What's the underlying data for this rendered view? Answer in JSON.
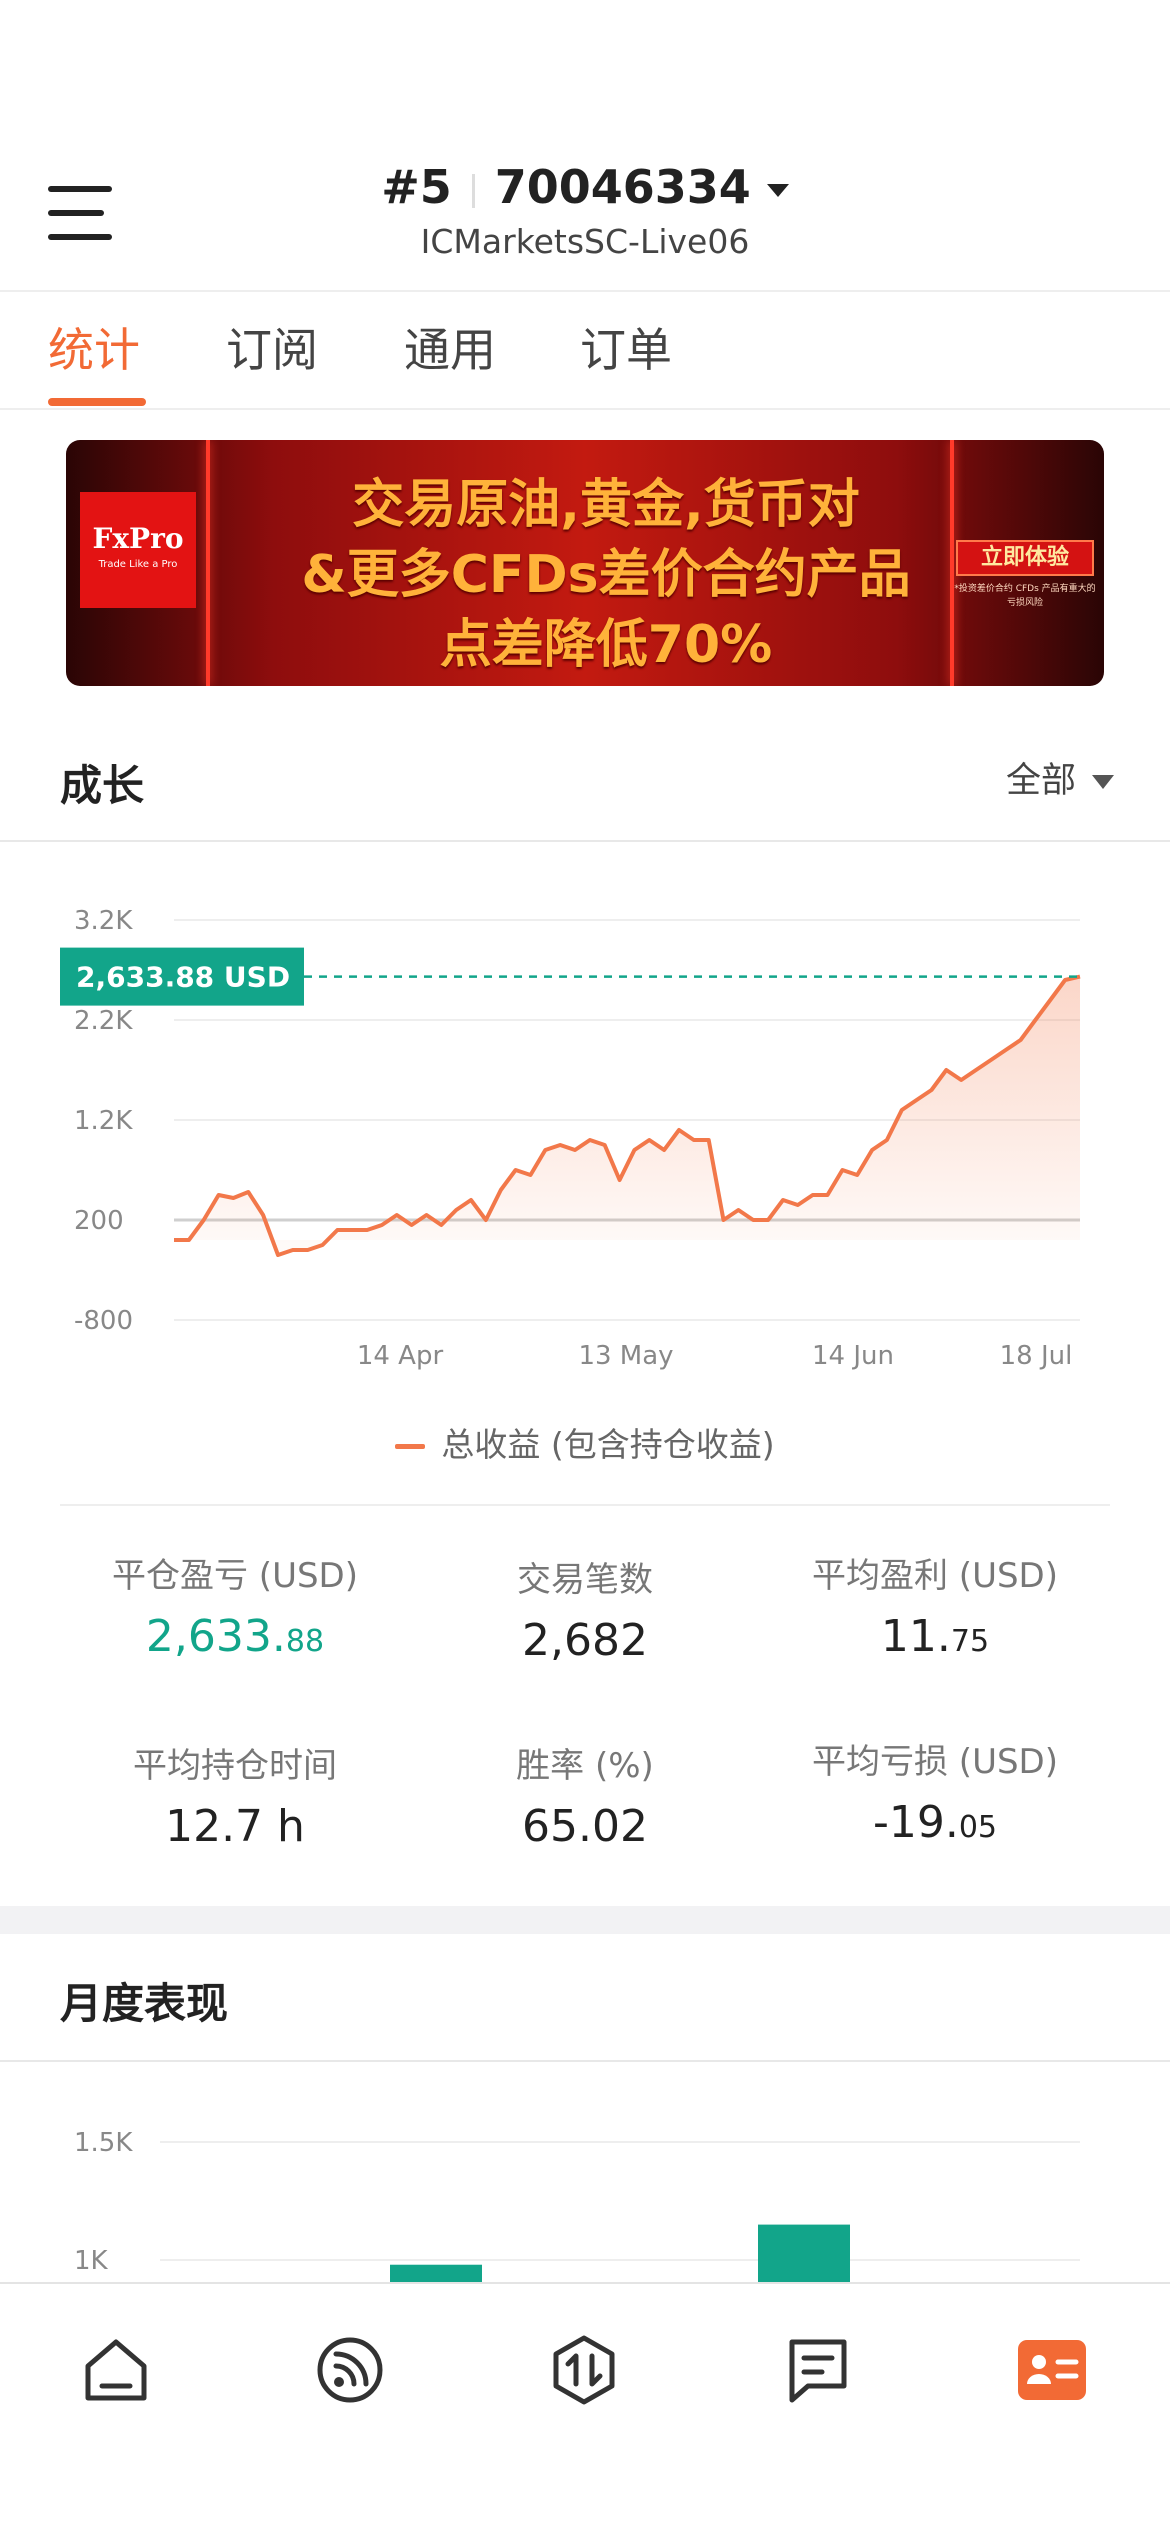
{
  "header": {
    "account_index": "#5",
    "account_number": "70046334",
    "server": "ICMarketsSC-Live06"
  },
  "tabs": [
    {
      "label": "统计",
      "active": true
    },
    {
      "label": "订阅",
      "active": false
    },
    {
      "label": "通用",
      "active": false
    },
    {
      "label": "订单",
      "active": false
    }
  ],
  "banner": {
    "brand": "FxPro",
    "brand_tagline": "Trade Like a Pro",
    "line1": "交易原油,黄金,货币对",
    "line2": "&更多CFDs差价合约产品",
    "line3": "点差降低70%",
    "cta": "立即体验",
    "cta_note": "*投资差价合约 CFDs 产品有重大的亏损风险"
  },
  "growth": {
    "title": "成长",
    "range": "全部",
    "current_value_label": "2,633.88 USD",
    "legend": "总收益 (包含持仓收益)"
  },
  "chart_data": [
    {
      "type": "area",
      "title": "成长",
      "yticks": [
        "3.2K",
        "2.2K",
        "1.2K",
        "200",
        "-800"
      ],
      "ylim": [
        -800,
        3200
      ],
      "xticks": [
        "14 Apr",
        "13 May",
        "14 Jun",
        "18 Jul"
      ],
      "series": [
        {
          "name": "总收益 (包含持仓收益)",
          "color": "#f2784a",
          "values": [
            0,
            0,
            200,
            450,
            420,
            480,
            250,
            -150,
            -100,
            -100,
            -50,
            100,
            100,
            100,
            150,
            250,
            150,
            250,
            150,
            300,
            400,
            200,
            500,
            700,
            650,
            900,
            950,
            900,
            1000,
            950,
            600,
            900,
            1000,
            900,
            1100,
            1000,
            1000,
            200,
            300,
            200,
            200,
            400,
            350,
            450,
            450,
            700,
            650,
            900,
            1000,
            1300,
            1400,
            1500,
            1700,
            1600,
            1700,
            1800,
            1900,
            2000,
            2200,
            2400,
            2600,
            2633.88
          ]
        }
      ],
      "reference_line": 2633.88,
      "grid": true
    },
    {
      "type": "bar",
      "title": "月度表现",
      "yticks": [
        "1.5K",
        "1K"
      ],
      "series": [
        {
          "name": "",
          "color": "#12a58a",
          "values": [
            980,
            1150
          ]
        }
      ]
    }
  ],
  "stats": [
    {
      "label": "平仓盈亏 (USD)",
      "int": "2,633.",
      "dec": "88",
      "green": true
    },
    {
      "label": "交易笔数",
      "int": "2,682",
      "dec": "",
      "green": false
    },
    {
      "label": "平均盈利 (USD)",
      "int": "11.",
      "dec": "75",
      "green": false
    },
    {
      "label": "平均持仓时间",
      "int": "12.7 h",
      "dec": "",
      "green": false
    },
    {
      "label": "胜率 (%)",
      "int": "65.02",
      "dec": "",
      "green": false
    },
    {
      "label": "平均亏损 (USD)",
      "int": "-19.",
      "dec": "05",
      "green": false
    }
  ],
  "monthly": {
    "title": "月度表现"
  },
  "colors": {
    "accent": "#f26a35",
    "positive": "#12a58a",
    "line": "#f2784a"
  },
  "nav": [
    {
      "icon": "home-icon"
    },
    {
      "icon": "feed-icon"
    },
    {
      "icon": "trade-icon"
    },
    {
      "icon": "chat-icon"
    },
    {
      "icon": "profile-card-icon",
      "active": true
    }
  ]
}
